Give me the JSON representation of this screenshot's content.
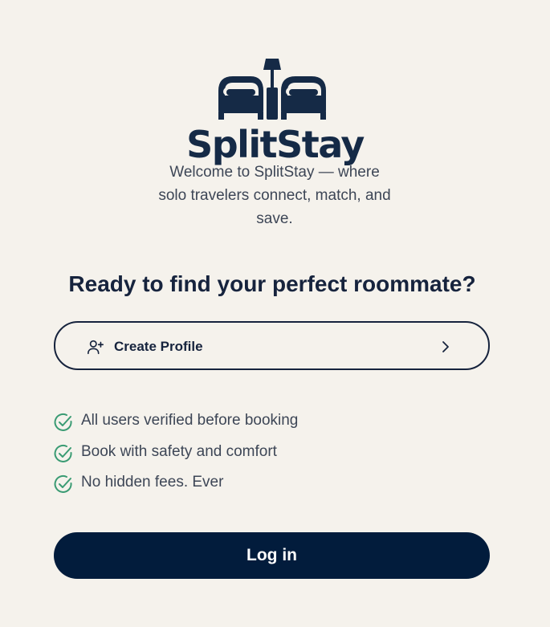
{
  "brand": {
    "name": "SplitStay",
    "tagline": "Welcome to SplitStay — where solo travelers connect, match, and save.",
    "logo_icon": "beds-and-lamp-icon"
  },
  "headline": "Ready to find your perfect roommate?",
  "create_profile": {
    "label": "Create Profile",
    "icon": "user-plus-icon",
    "trailing_icon": "chevron-right-icon"
  },
  "features": [
    {
      "icon": "check-circle-icon",
      "text": "All users verified before booking"
    },
    {
      "icon": "check-circle-icon",
      "text": "Book with safety and comfort"
    },
    {
      "icon": "check-circle-icon",
      "text": "No hidden fees. Ever"
    }
  ],
  "login": {
    "label": "Log in"
  },
  "colors": {
    "background": "#f5f2ec",
    "brand_navy": "#152a46",
    "button_navy": "#021c3c",
    "check_green": "#3a9b73"
  }
}
